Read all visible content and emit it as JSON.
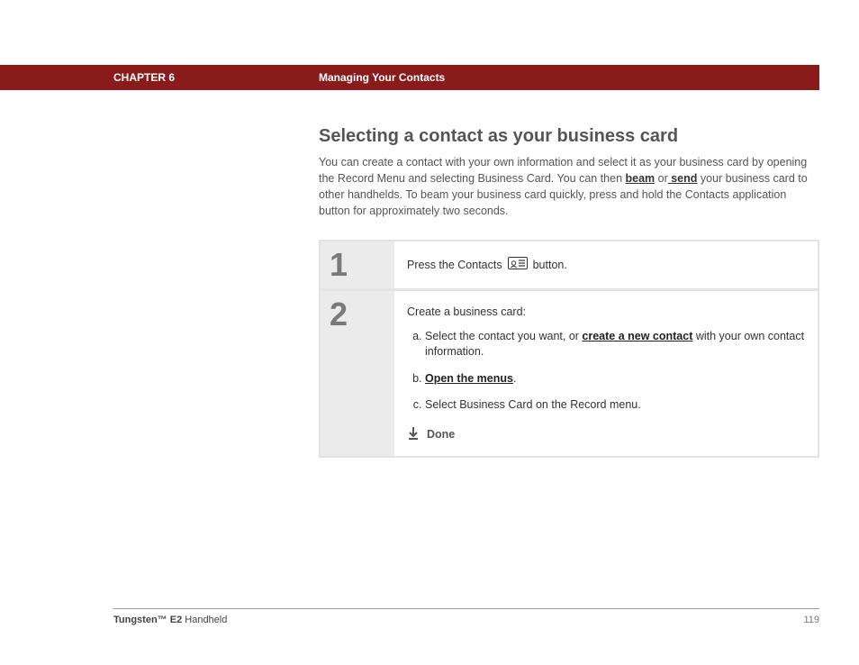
{
  "header": {
    "chapter": "CHAPTER 6",
    "title": "Managing Your Contacts"
  },
  "section": {
    "title": "Selecting a contact as your business card",
    "intro_pre": "You can create a contact with your own information and select it as your business card by opening the Record Menu and selecting Business Card. You can then ",
    "intro_link1": "beam",
    "intro_mid": " or",
    "intro_link2": " send",
    "intro_post": " your business card to other handhelds. To beam your business card quickly, press and hold the Contacts application button for approximately two seconds."
  },
  "steps": {
    "s1": {
      "num": "1",
      "pre": "Press the Contacts ",
      "post": " button."
    },
    "s2": {
      "num": "2",
      "lead": "Create a business card:",
      "a_pre": "Select the contact you want, or ",
      "a_link": "create a new contact",
      "a_post": " with your own contact information.",
      "b_link": "Open the menus",
      "b_post": ".",
      "c": "Select Business Card on the Record menu.",
      "done": "Done"
    }
  },
  "footer": {
    "product_bold": "Tungsten™ E2",
    "product_rest": " Handheld",
    "page": "119"
  }
}
